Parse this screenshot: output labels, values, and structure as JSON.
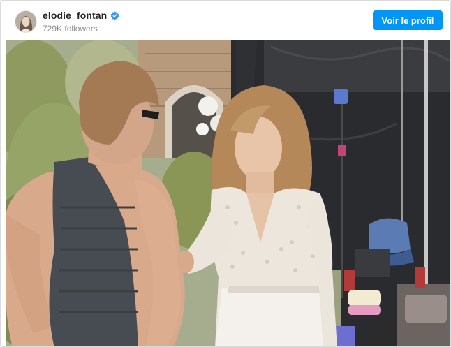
{
  "header": {
    "username": "elodie_fontan",
    "followers": "729K followers",
    "profile_button": "Voir le profil",
    "verified_icon": "verified-badge-icon"
  },
  "colors": {
    "accent": "#0095f6",
    "verified": "#3897f0",
    "username": "#262626",
    "secondary_text": "#8e8e8e"
  },
  "photo": {
    "subject": "post-photo"
  }
}
